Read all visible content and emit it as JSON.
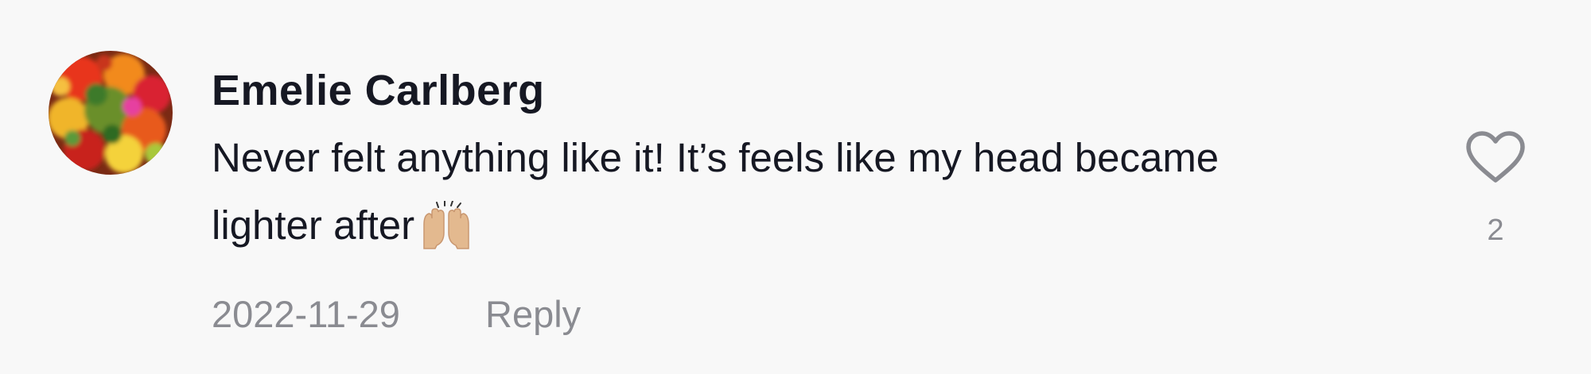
{
  "comment": {
    "username": "Emelie Carlberg",
    "text": "Never felt anything like it! It’s feels like my head became lighter after",
    "emoji": "raising-hands",
    "date": "2022-11-29",
    "reply_label": "Reply",
    "like_count": "2",
    "like_icon": "heart-outline-icon"
  },
  "colors": {
    "background": "#f8f8f8",
    "username": "#161823",
    "text": "#161823",
    "meta": "#8a8b91",
    "icon": "#8a8b91"
  }
}
